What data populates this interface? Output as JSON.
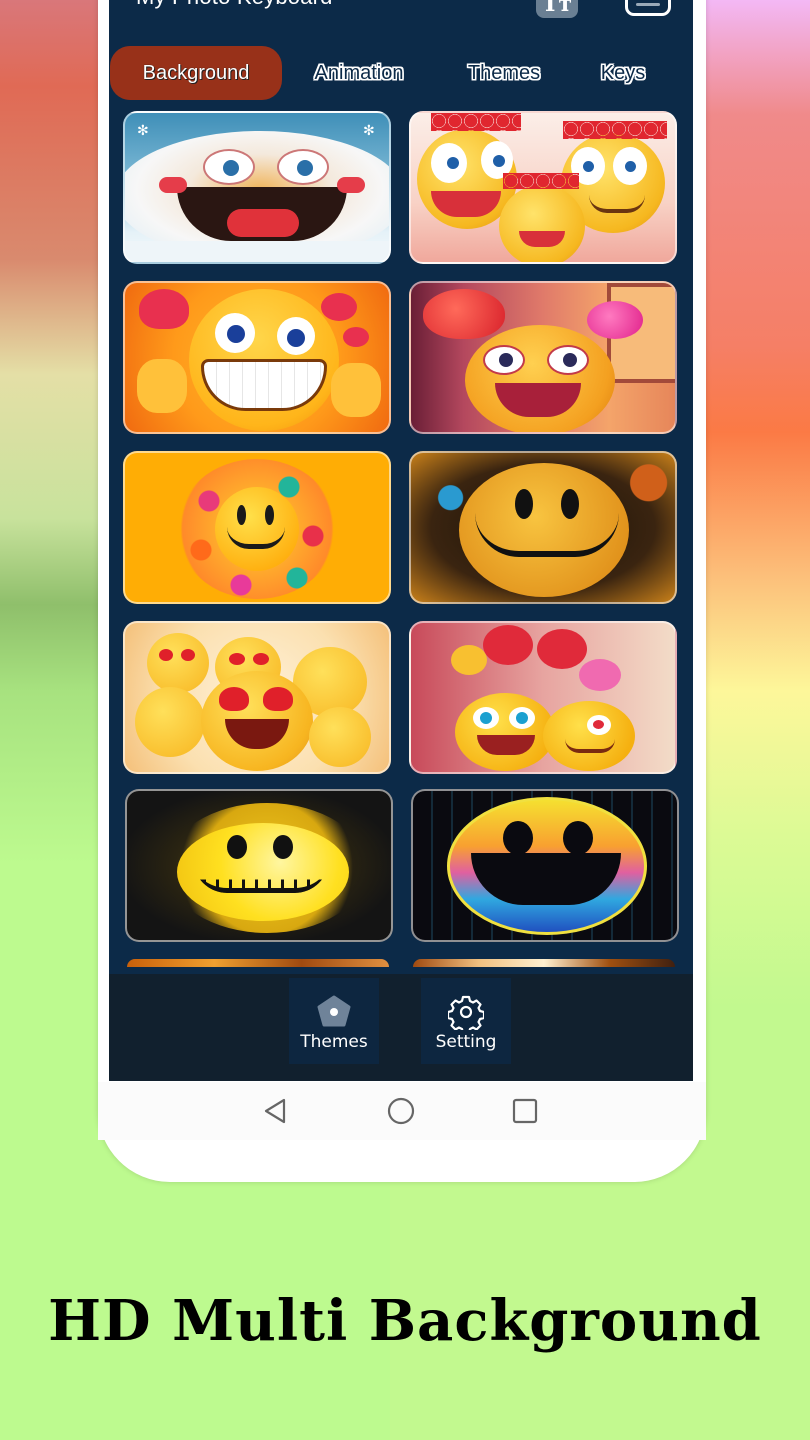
{
  "app": {
    "title": "My Photo Keyboard",
    "font_button_glyph": "Tт",
    "font_button_icon": "font-size-icon",
    "menu_button_icon": "keyboard-hide-icon"
  },
  "tabs": [
    {
      "label": "Background",
      "active": true
    },
    {
      "label": "Animation",
      "active": false
    },
    {
      "label": "Themes",
      "active": false
    },
    {
      "label": "Keys",
      "active": false
    }
  ],
  "backgrounds": [
    {
      "name": "snowball-laughing-emoji",
      "theme": "snow"
    },
    {
      "name": "three-emojis-with-heart-crowns",
      "theme": "hearts-crowns"
    },
    {
      "name": "grinning-emoji-with-hearts-orange",
      "theme": "orange-hearts"
    },
    {
      "name": "love-emoji-with-balloons-window",
      "theme": "pink-room"
    },
    {
      "name": "smiley-surrounded-by-candy-balls",
      "theme": "candy"
    },
    {
      "name": "grunge-splatter-smiley",
      "theme": "grunge"
    },
    {
      "name": "heart-eyes-emoji-crowd",
      "theme": "heart-eyes"
    },
    {
      "name": "two-emojis-with-heart-balloons",
      "theme": "balloons"
    },
    {
      "name": "yellow-paint-splash-smiley",
      "theme": "splash"
    },
    {
      "name": "neon-rainbow-smiley",
      "theme": "neon"
    }
  ],
  "bottom_nav": [
    {
      "label": "Themes",
      "icon": "pentagon-theme-icon"
    },
    {
      "label": "Setting",
      "icon": "gear-icon"
    }
  ],
  "system_nav": {
    "back": "back-triangle-icon",
    "home": "home-circle-icon",
    "recents": "recents-square-icon"
  },
  "colors": {
    "screen_bg": "#0c2a48",
    "active_tab": "#983119",
    "bottom_nav_bg": "#11202e",
    "canvas_green": "#c2f98f"
  },
  "caption": "HD Multi Background"
}
